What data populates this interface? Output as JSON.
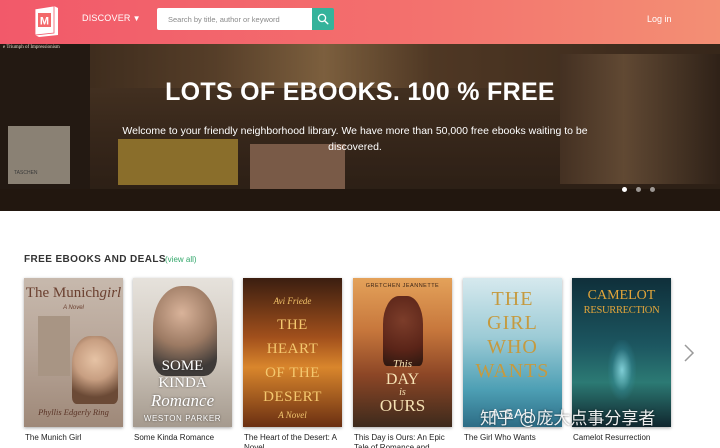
{
  "header": {
    "discover_label": "DISCOVER",
    "search_placeholder": "Search by title, author or keyword",
    "login_label": "Log in",
    "logo_letter": "M"
  },
  "hero": {
    "title": "LOTS OF EBOOKS. 100 % FREE",
    "subtitle": "Welcome to your friendly neighborhood library. We have more than 50,000 free ebooks waiting to be discovered.",
    "slides": [
      1,
      2,
      3
    ],
    "active_slide": 1,
    "background_text": {
      "book_spine": "e Triumph of Impressionism",
      "book_taschen": "TASCHEN"
    }
  },
  "section": {
    "title": "FREE EBOOKS AND DEALS",
    "view_all": "(view all)"
  },
  "books": [
    {
      "title": "The Munich Girl",
      "cover": {
        "line1": "The",
        "line2": "Munich",
        "line3": "girl",
        "tagline": "A Novel",
        "author": "Phyllis Edgerly Ring"
      }
    },
    {
      "title": "Some Kinda Romance",
      "cover": {
        "line1": "SOME",
        "line2": "KINDA",
        "line3": "Romance",
        "author": "WESTON PARKER"
      }
    },
    {
      "title": "The Heart of the Desert: A Novel",
      "cover": {
        "author": "Avi Friede",
        "line1": "THE",
        "line2": "HEART",
        "line3": "OF THE",
        "line4": "DESERT",
        "tagline": "A Novel"
      }
    },
    {
      "title": "This Day is Ours: An Epic Tale of Romance and",
      "cover": {
        "author": "GRETCHEN JEANNETTE",
        "line1": "This",
        "line2": "DAY",
        "line3": "is",
        "line4": "OURS"
      }
    },
    {
      "title": "The Girl Who Wants",
      "cover": {
        "line1": "THE",
        "line2": "GIRL",
        "line3": "WHO",
        "line4": "WANTS",
        "author": "A SAU"
      }
    },
    {
      "title": "Camelot Resurrection",
      "cover": {
        "line1": "CAMELOT",
        "line2": "RESURRECTION"
      }
    }
  ],
  "watermark": "知乎 @庞大点事分享者",
  "colors": {
    "accent_green": "#35b39b",
    "header_start": "#f2596a",
    "header_end": "#f38f74"
  }
}
